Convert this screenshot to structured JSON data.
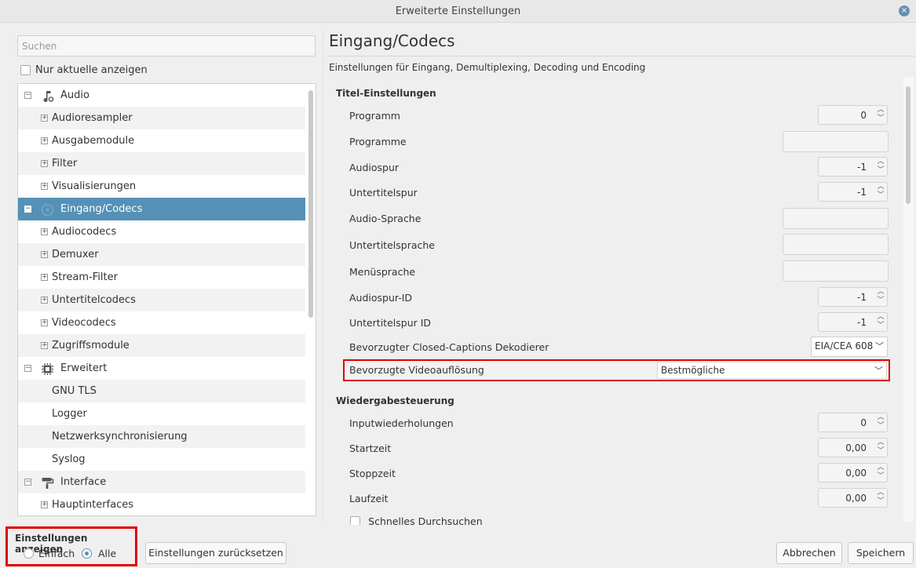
{
  "window": {
    "title": "Erweiterte Einstellungen",
    "close_icon": "×"
  },
  "left": {
    "search_placeholder": "Suchen",
    "only_current_label": "Nur aktuelle anzeigen",
    "tree": [
      {
        "label": "Audio",
        "level": 0,
        "expander": "−",
        "icon": "audio-settings-icon"
      },
      {
        "label": "Audioresampler",
        "level": 1,
        "expander": "+"
      },
      {
        "label": "Ausgabemodule",
        "level": 1,
        "expander": "+"
      },
      {
        "label": "Filter",
        "level": 1,
        "expander": "+"
      },
      {
        "label": "Visualisierungen",
        "level": 1,
        "expander": "+"
      },
      {
        "label": "Eingang/Codecs",
        "level": 0,
        "expander": "−",
        "icon": "codec-disc-icon",
        "selected": true
      },
      {
        "label": "Audiocodecs",
        "level": 1,
        "expander": "+"
      },
      {
        "label": "Demuxer",
        "level": 1,
        "expander": "+"
      },
      {
        "label": "Stream-Filter",
        "level": 1,
        "expander": "+"
      },
      {
        "label": "Untertitelcodecs",
        "level": 1,
        "expander": "+"
      },
      {
        "label": "Videocodecs",
        "level": 1,
        "expander": "+"
      },
      {
        "label": "Zugriffsmodule",
        "level": 1,
        "expander": "+"
      },
      {
        "label": "Erweitert",
        "level": 0,
        "expander": "−",
        "icon": "chip-icon"
      },
      {
        "label": "GNU TLS",
        "level": 1,
        "expander": ""
      },
      {
        "label": "Logger",
        "level": 1,
        "expander": ""
      },
      {
        "label": "Netzwerksynchronisierung",
        "level": 1,
        "expander": ""
      },
      {
        "label": "Syslog",
        "level": 1,
        "expander": ""
      },
      {
        "label": "Interface",
        "level": 0,
        "expander": "−",
        "icon": "paint-roller-icon"
      },
      {
        "label": "Hauptinterfaces",
        "level": 1,
        "expander": "+"
      }
    ]
  },
  "main": {
    "title": "Eingang/Codecs",
    "description": "Einstellungen für Eingang, Demultiplexing, Decoding und Encoding",
    "group1_title": "Titel-Einstellungen",
    "group2_title": "Wiedergabesteuerung",
    "fields": {
      "programm": {
        "label": "Programm",
        "value": "0"
      },
      "programme": {
        "label": "Programme",
        "value": ""
      },
      "audiospur": {
        "label": "Audiospur",
        "value": "-1"
      },
      "untertitelspur": {
        "label": "Untertitelspur",
        "value": "-1"
      },
      "audio_sprache": {
        "label": "Audio-Sprache",
        "value": ""
      },
      "untertitelsprache": {
        "label": "Untertitelsprache",
        "value": ""
      },
      "menuesprache": {
        "label": "Menüsprache",
        "value": ""
      },
      "audiospur_id": {
        "label": "Audiospur-ID",
        "value": "-1"
      },
      "untertitelspur_id": {
        "label": "Untertitelspur ID",
        "value": "-1"
      },
      "cc_decoder": {
        "label": "Bevorzugter Closed-Captions Dekodierer",
        "value": "EIA/CEA 608"
      },
      "video_resolution": {
        "label": "Bevorzugte Videoauflösung",
        "value": "Bestmögliche"
      },
      "input_repeats": {
        "label": "Inputwiederholungen",
        "value": "0"
      },
      "startzeit": {
        "label": "Startzeit",
        "value": "0,00"
      },
      "stoppzeit": {
        "label": "Stoppzeit",
        "value": "0,00"
      },
      "laufzeit": {
        "label": "Laufzeit",
        "value": "0,00"
      },
      "fast_seek": {
        "label": "Schnelles Durchsuchen"
      }
    }
  },
  "bottom": {
    "show_settings_title": "Einstellungen anzeigen",
    "radio_simple": "Einfach",
    "radio_all": "Alle",
    "reset_button": "Einstellungen zurücksetzen",
    "cancel_button": "Abbrechen",
    "save_button": "Speichern"
  },
  "colors": {
    "selection": "#5591b6",
    "highlight_border": "#e00000"
  }
}
